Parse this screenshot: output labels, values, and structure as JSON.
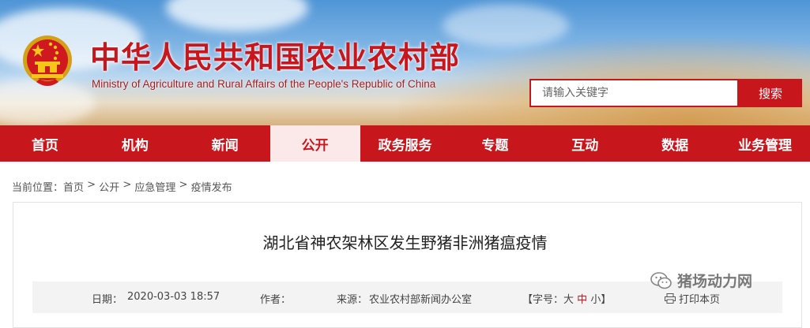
{
  "header": {
    "title_cn": "中华人民共和国农业农村部",
    "title_en": "Ministry of Agriculture  and  Rural  Affairs  of the People's Republic of China",
    "emblem_icon": "national-emblem-icon"
  },
  "search": {
    "placeholder": "请输入关键字",
    "button_label": "搜索"
  },
  "nav": {
    "items": [
      {
        "label": "首页"
      },
      {
        "label": "机构"
      },
      {
        "label": "新闻"
      },
      {
        "label": "公开"
      },
      {
        "label": "政务服务"
      },
      {
        "label": "专题"
      },
      {
        "label": "互动"
      },
      {
        "label": "数据"
      },
      {
        "label": "业务管理"
      }
    ],
    "active_index": 3
  },
  "breadcrumb": {
    "prefix": "当前位置：",
    "items": [
      "首页",
      "公开",
      "应急管理",
      "疫情发布"
    ],
    "separator": " > "
  },
  "article": {
    "title": "湖北省神农架林区发生野猪非洲猪瘟疫情",
    "date_label": "日期：",
    "date": "2020-03-03 18:57",
    "author_label": "作者：",
    "source_label": "来源：",
    "source": "农业农村部新闻办公室",
    "font_size_label": "【字号：",
    "font_large": "大",
    "font_medium": "中",
    "font_small": "小",
    "font_close": "】",
    "print_label": "打印本页"
  },
  "watermark": {
    "text": "猪场动力网",
    "icon": "wechat-icon"
  },
  "colors": {
    "brand_red": "#c8161d",
    "active_tab_bg": "#fbe9e9",
    "meta_bg": "#f3f3f3"
  }
}
